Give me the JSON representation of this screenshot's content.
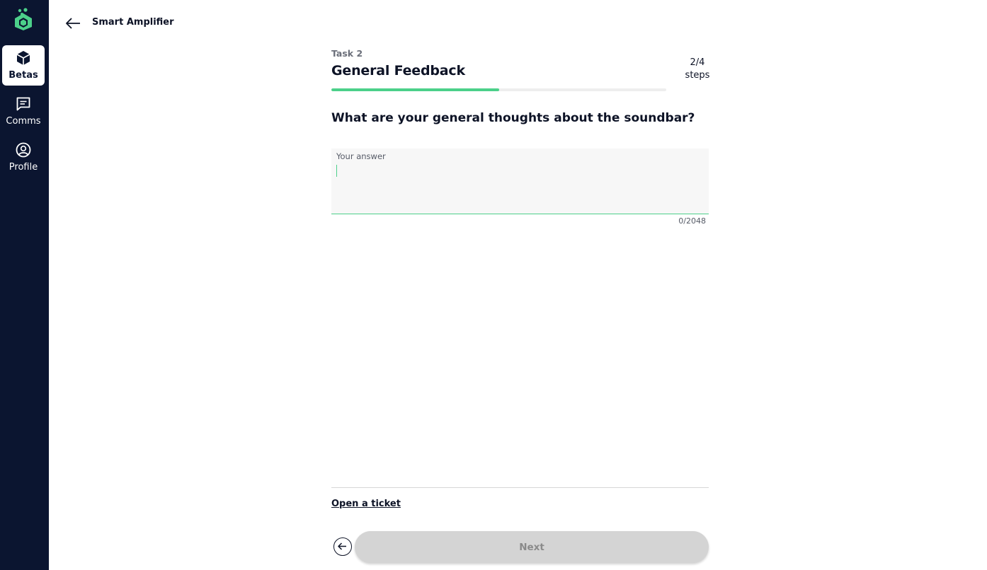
{
  "sidebar": {
    "items": [
      {
        "label": "Betas",
        "icon": "cube-icon",
        "active": true
      },
      {
        "label": "Comms",
        "icon": "chat-icon",
        "active": false
      },
      {
        "label": "Profile",
        "icon": "user-circle-icon",
        "active": false
      }
    ]
  },
  "header": {
    "title": "Smart Amplifier"
  },
  "task": {
    "label": "Task 2",
    "title": "General Feedback",
    "steps_count": "2/4",
    "steps_word": "steps",
    "progress_fraction": 0.5
  },
  "question": {
    "text": "What are your general thoughts about the soundbar?",
    "answer_label": "Your answer",
    "answer_value": "",
    "counter": "0/2048"
  },
  "footer": {
    "ticket_link": "Open a ticket",
    "next_label": "Next"
  },
  "colors": {
    "sidebar_bg": "#0b1530",
    "accent": "#4cd08a",
    "disabled_button": "#d4d4d4"
  }
}
